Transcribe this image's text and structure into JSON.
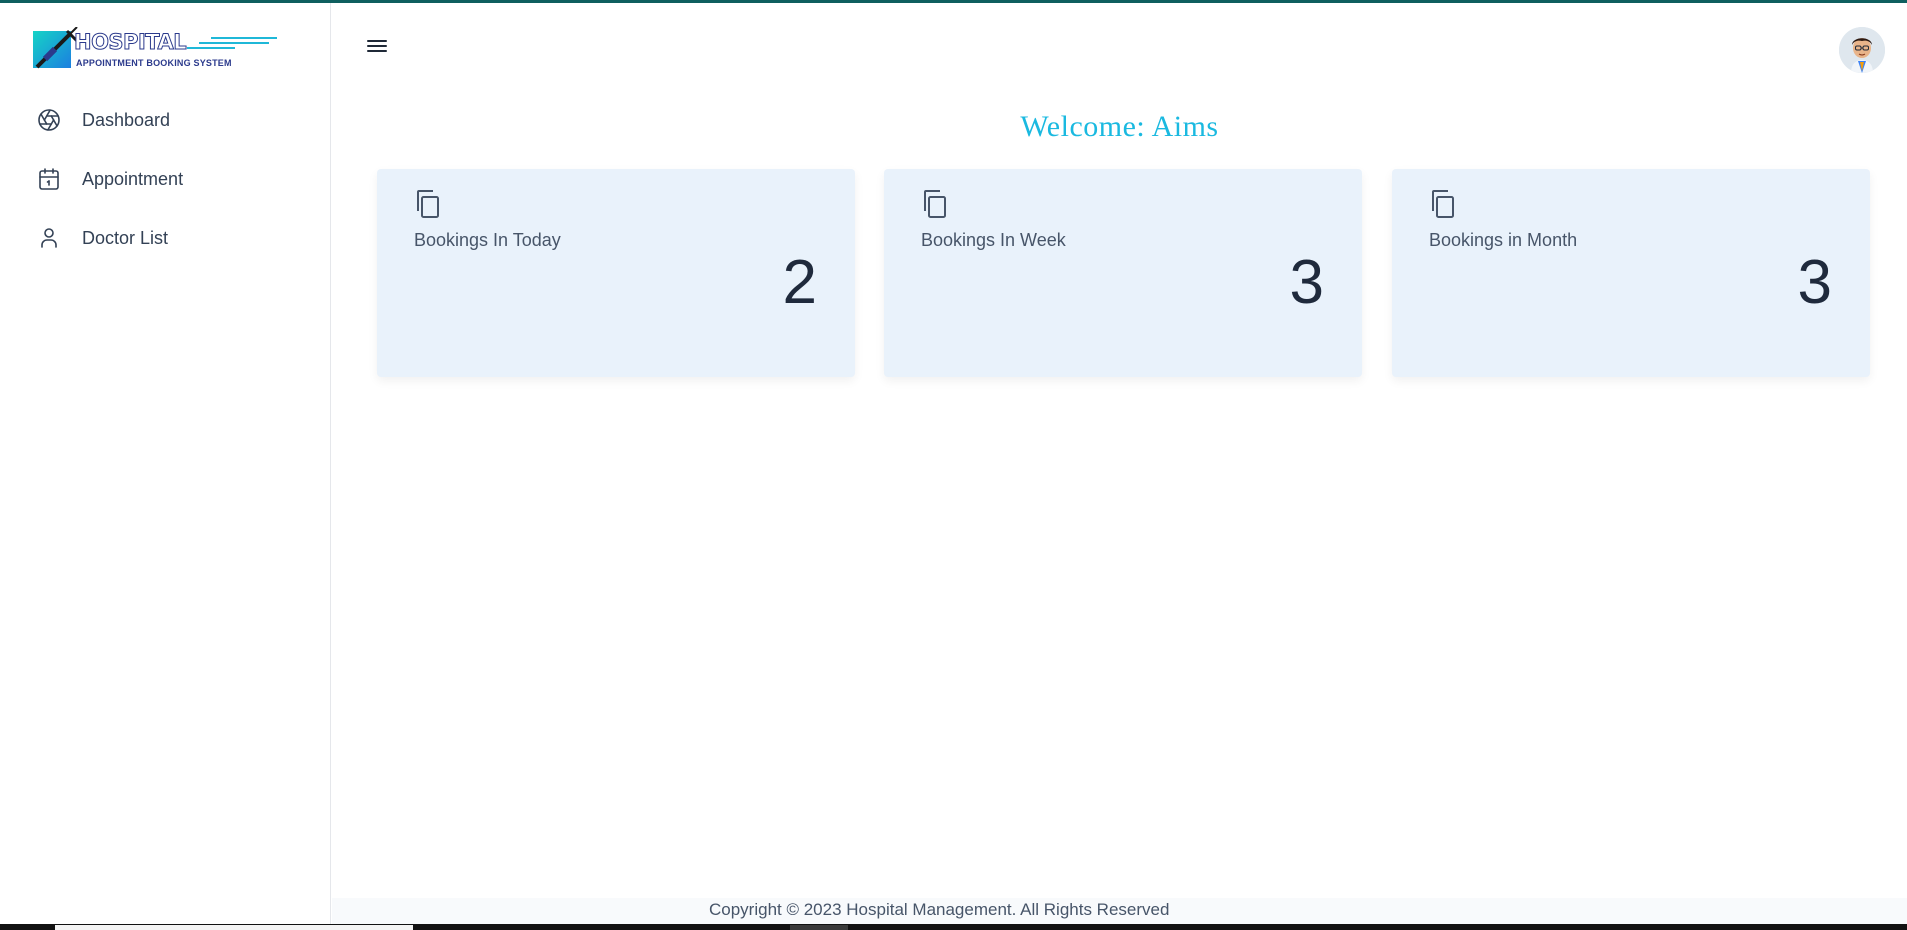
{
  "app": {
    "logo_title": "HOSPITAL",
    "logo_subtitle": "APPOINTMENT BOOKING SYSTEM"
  },
  "sidebar": {
    "items": [
      {
        "label": "Dashboard",
        "icon": "aperture-icon"
      },
      {
        "label": "Appointment",
        "icon": "calendar-icon"
      },
      {
        "label": "Doctor List",
        "icon": "user-icon"
      }
    ]
  },
  "header": {
    "menu_icon": "hamburger-menu-icon",
    "avatar_icon": "user-avatar"
  },
  "main": {
    "welcome": "Welcome: Aims",
    "cards": [
      {
        "title": "Bookings In Today",
        "value": "2",
        "icon": "copy-icon"
      },
      {
        "title": "Bookings In Week",
        "value": "3",
        "icon": "copy-icon"
      },
      {
        "title": "Bookings in Month",
        "value": "3",
        "icon": "copy-icon"
      }
    ]
  },
  "footer": {
    "text": "Copyright © 2023 Hospital Management. All Rights Reserved"
  },
  "colors": {
    "accent": "#1ab9e0",
    "card_bg": "#e9f2fb",
    "top_border": "#0f5f5f"
  }
}
